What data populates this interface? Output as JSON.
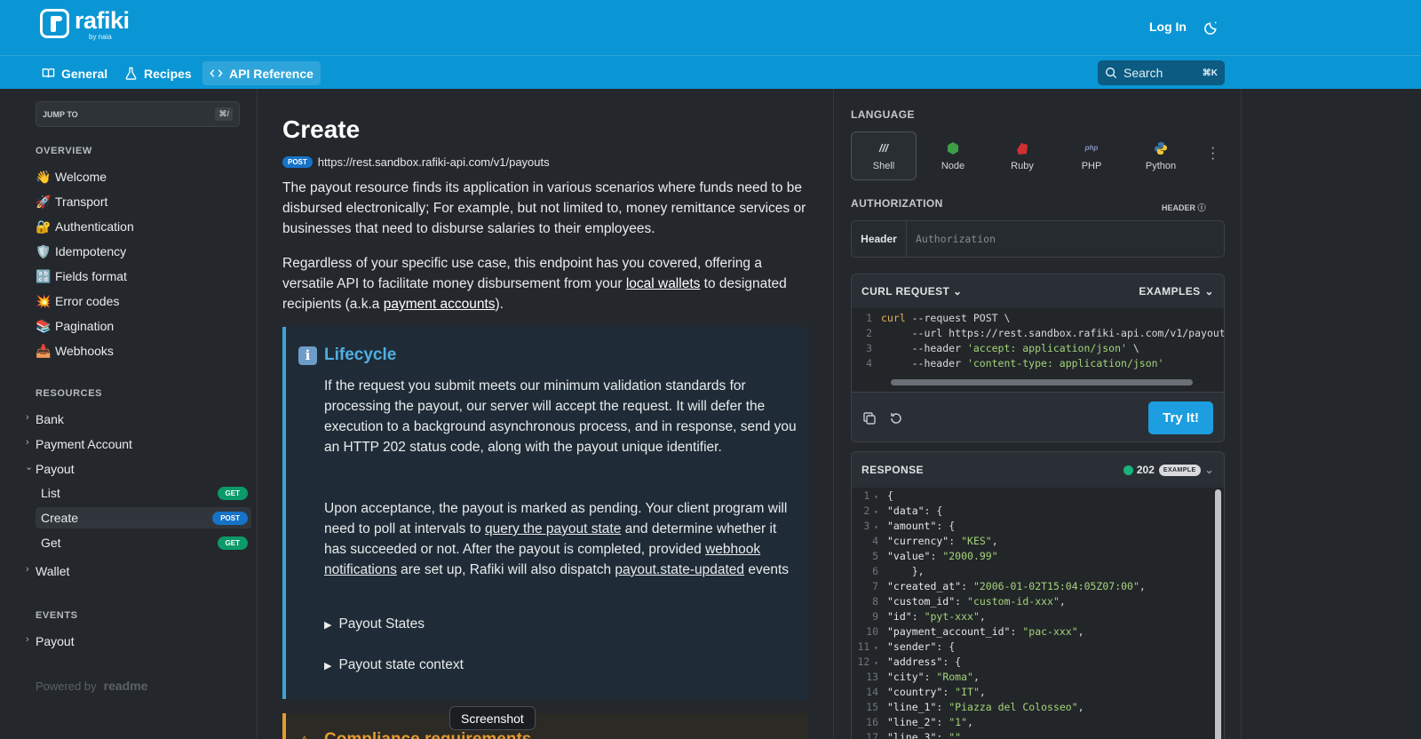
{
  "brand": {
    "name": "rafiki",
    "by": "by naia"
  },
  "header": {
    "login": "Log In"
  },
  "nav": {
    "tabs": [
      {
        "label": "General"
      },
      {
        "label": "Recipes"
      },
      {
        "label": "API Reference"
      }
    ],
    "search": {
      "label": "Search",
      "shortcut": "⌘K"
    }
  },
  "sidebar": {
    "jump": {
      "label": "JUMP TO",
      "shortcut": "⌘/"
    },
    "overview_title": "OVERVIEW",
    "overview": [
      {
        "emoji": "👋",
        "label": "Welcome"
      },
      {
        "emoji": "🚀",
        "label": "Transport"
      },
      {
        "emoji": "🔐",
        "label": "Authentication"
      },
      {
        "emoji": "🛡️",
        "label": "Idempotency"
      },
      {
        "emoji": "🔡",
        "label": "Fields format"
      },
      {
        "emoji": "💥",
        "label": "Error codes"
      },
      {
        "emoji": "📚",
        "label": "Pagination"
      },
      {
        "emoji": "📥",
        "label": "Webhooks"
      }
    ],
    "resources_title": "RESOURCES",
    "resources": [
      {
        "label": "Bank"
      },
      {
        "label": "Payment Account"
      },
      {
        "label": "Payout"
      }
    ],
    "payout_children": [
      {
        "label": "List",
        "method": "GET"
      },
      {
        "label": "Create",
        "method": "POST"
      },
      {
        "label": "Get",
        "method": "GET"
      }
    ],
    "wallet": "Wallet",
    "events_title": "EVENTS",
    "events": [
      {
        "label": "Payout"
      }
    ],
    "powered_by": "Powered by",
    "powered_brand": "readme"
  },
  "main": {
    "title": "Create",
    "method": "POST",
    "url": "https://rest.sandbox.rafiki-api.com/v1/payouts",
    "p1": "The payout resource finds its application in various scenarios where funds need to be disbursed electronically; For example, but not limited to, money remittance services or businesses that need to disburse salaries to their employees.",
    "p2_a": "Regardless of your specific use case, this endpoint has you covered, offering a versatile API to facilitate money disbursement from your ",
    "p2_link1": "local wallets",
    "p2_b": " to designated recipients (a.k.a ",
    "p2_link2": "payment accounts",
    "p2_c": ").",
    "callout": {
      "title": "Lifecycle",
      "text1": "If the request you submit meets our minimum validation standards for processing the payout, our server will accept the request. It will defer the execution to a background asynchronous process, and in response, send you an HTTP 202 status code, along with the payout unique identifier.",
      "text2_a": "Upon acceptance, the payout is marked as pending. Your client program will need to poll at intervals to ",
      "text2_link1": "query the payout state",
      "text2_b": " and determine whether it has succeeded or not. After the payout is completed, provided ",
      "text2_link2": "webhook notifications",
      "text2_c": " are set up, Rafiki will also dispatch ",
      "text2_link3": "payout.state-updated",
      "text2_d": " events",
      "details1": "Payout States",
      "details2": "Payout state context"
    },
    "callout2_title": "Compliance requirements",
    "tooltip": "Screenshot"
  },
  "right": {
    "language_label": "LANGUAGE",
    "languages": [
      {
        "label": "Shell"
      },
      {
        "label": "Node"
      },
      {
        "label": "Ruby"
      },
      {
        "label": "PHP"
      },
      {
        "label": "Python"
      }
    ],
    "authorization_label": "AUTHORIZATION",
    "header_tag": "HEADER",
    "auth_key": "Header",
    "auth_placeholder": "Authorization",
    "curl_label": "CURL REQUEST",
    "examples_label": "EXAMPLES",
    "try_label": "Try It!",
    "response_label": "RESPONSE",
    "status_code": "202",
    "status_badge": "EXAMPLE",
    "colors": {
      "accent": "#0a96d4",
      "get": "#0b9a69",
      "post": "#1673c8",
      "try": "#1d9ee0"
    }
  }
}
